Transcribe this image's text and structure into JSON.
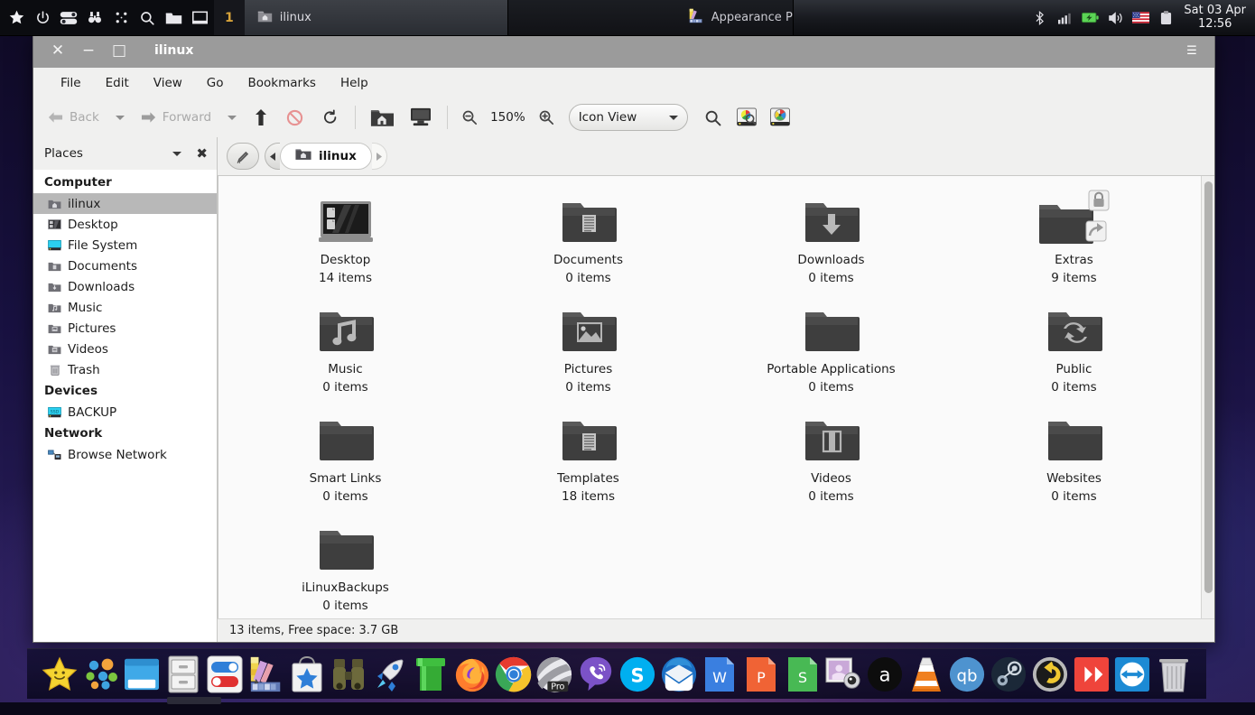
{
  "top_panel": {
    "launcher_icons": [
      "star-icon",
      "power-icon",
      "toggles-icon",
      "binoculars-icon",
      "grid-dots-icon",
      "search-icon",
      "folder-icon",
      "window-icon"
    ],
    "workspace_number": "1",
    "tasks": [
      {
        "label": "ilinux",
        "icon": "home-folder-icon",
        "active": true
      },
      {
        "label": "Appearance Preferences",
        "icon": "appearance-icon",
        "active": false
      }
    ],
    "tray_icons": [
      "bluetooth-icon",
      "signal-icon",
      "battery-icon",
      "volume-icon",
      "us-flag-icon",
      "clipboard-icon"
    ],
    "clock": {
      "date": "Sat 03 Apr",
      "time": "12:56"
    }
  },
  "window": {
    "title": "ilinux",
    "buttons": {
      "close": "✕",
      "minimize": "−",
      "maximize": "□",
      "menu": "☰"
    },
    "menubar": [
      "File",
      "Edit",
      "View",
      "Go",
      "Bookmarks",
      "Help"
    ],
    "toolbar": {
      "back_label": "Back",
      "forward_label": "Forward",
      "up_icon": "up-arrow-icon",
      "stop_icon": "stop-icon",
      "reload_icon": "reload-icon",
      "home_icon": "home-folder-icon",
      "computer_icon": "computer-icon",
      "zoom_out_icon": "zoom-out-icon",
      "zoom_level": "150%",
      "zoom_in_icon": "zoom-in-icon",
      "view_mode": "Icon View",
      "search_icon": "search-icon",
      "disk_usage_icon": "disk-analyzer-icon",
      "disk_info_icon": "disk-info-icon"
    },
    "pathbar": {
      "edit_icon": "pencil-icon",
      "prev_icon": "chevron-left-icon",
      "next_icon": "chevron-right-icon",
      "crumb": {
        "label": "ilinux",
        "icon": "home-folder-icon"
      }
    },
    "sidebar": {
      "header": "Places",
      "header_dropdown_icon": "chevron-down-icon",
      "header_close_icon": "close-icon",
      "groups": [
        {
          "title": "Computer",
          "items": [
            {
              "label": "ilinux",
              "icon": "home-folder-icon",
              "selected": true
            },
            {
              "label": "Desktop",
              "icon": "desktop-icon",
              "selected": false
            },
            {
              "label": "File System",
              "icon": "drive-icon",
              "selected": false
            },
            {
              "label": "Documents",
              "icon": "documents-folder-icon",
              "selected": false
            },
            {
              "label": "Downloads",
              "icon": "downloads-folder-icon",
              "selected": false
            },
            {
              "label": "Music",
              "icon": "music-folder-icon",
              "selected": false
            },
            {
              "label": "Pictures",
              "icon": "pictures-folder-icon",
              "selected": false
            },
            {
              "label": "Videos",
              "icon": "videos-folder-icon",
              "selected": false
            },
            {
              "label": "Trash",
              "icon": "trash-icon",
              "selected": false
            }
          ]
        },
        {
          "title": "Devices",
          "items": [
            {
              "label": "BACKUP",
              "icon": "ssd-drive-icon",
              "selected": false
            }
          ]
        },
        {
          "title": "Network",
          "items": [
            {
              "label": "Browse Network",
              "icon": "network-icon",
              "selected": false
            }
          ]
        }
      ]
    },
    "files": [
      {
        "name": "Desktop",
        "count": "14 items",
        "icon": "desktop-monitor-icon",
        "badge": ""
      },
      {
        "name": "Documents",
        "count": "0 items",
        "icon": "documents-folder-icon",
        "badge": ""
      },
      {
        "name": "Downloads",
        "count": "0 items",
        "icon": "downloads-folder-icon",
        "badge": ""
      },
      {
        "name": "Extras",
        "count": "9 items",
        "icon": "plain-folder-icon",
        "badge": "lock-and-link"
      },
      {
        "name": "Music",
        "count": "0 items",
        "icon": "music-folder-icon",
        "badge": ""
      },
      {
        "name": "Pictures",
        "count": "0 items",
        "icon": "pictures-folder-icon",
        "badge": ""
      },
      {
        "name": "Portable Applications",
        "count": "0 items",
        "icon": "plain-folder-icon",
        "badge": ""
      },
      {
        "name": "Public",
        "count": "0 items",
        "icon": "public-folder-icon",
        "badge": ""
      },
      {
        "name": "Smart Links",
        "count": "0 items",
        "icon": "plain-folder-icon",
        "badge": ""
      },
      {
        "name": "Templates",
        "count": "18 items",
        "icon": "templates-folder-icon",
        "badge": ""
      },
      {
        "name": "Videos",
        "count": "0 items",
        "icon": "videos-folder-icon",
        "badge": ""
      },
      {
        "name": "Websites",
        "count": "0 items",
        "icon": "plain-folder-icon",
        "badge": ""
      },
      {
        "name": "iLinuxBackups",
        "count": "0 items",
        "icon": "plain-folder-icon",
        "badge": ""
      }
    ],
    "statusbar": "13 items, Free space: 3.7 GB"
  },
  "dock": {
    "items": [
      {
        "name": "menu-star",
        "icon": "smiley-star-icon"
      },
      {
        "name": "applications",
        "icon": "colored-dots-icon"
      },
      {
        "name": "window-switcher",
        "icon": "blue-window-icon"
      },
      {
        "name": "file-cabinet",
        "icon": "file-cabinet-icon"
      },
      {
        "name": "settings",
        "icon": "toggles-icon"
      },
      {
        "name": "appearance",
        "icon": "color-palette-icon"
      },
      {
        "name": "software-store",
        "icon": "shopping-bag-star-icon"
      },
      {
        "name": "search-files",
        "icon": "binoculars-icon"
      },
      {
        "name": "launcher",
        "icon": "rocket-icon"
      },
      {
        "name": "terminal",
        "icon": "green-pipe-icon"
      },
      {
        "name": "firefox",
        "icon": "firefox-icon"
      },
      {
        "name": "chrome",
        "icon": "chrome-icon"
      },
      {
        "name": "opera-pro",
        "icon": "pro-browser-icon"
      },
      {
        "name": "viber",
        "icon": "viber-icon"
      },
      {
        "name": "skype",
        "icon": "skype-icon"
      },
      {
        "name": "thunderbird",
        "icon": "thunderbird-icon"
      },
      {
        "name": "writer",
        "icon": "writer-w-icon"
      },
      {
        "name": "impress",
        "icon": "impress-p-icon"
      },
      {
        "name": "calc",
        "icon": "calc-s-icon"
      },
      {
        "name": "screenshot",
        "icon": "screenshot-icon"
      },
      {
        "name": "amazon",
        "icon": "amazon-a-icon"
      },
      {
        "name": "vlc",
        "icon": "vlc-cone-icon"
      },
      {
        "name": "qbittorrent",
        "icon": "qbittorrent-icon"
      },
      {
        "name": "steam",
        "icon": "steam-icon"
      },
      {
        "name": "restore",
        "icon": "undo-arrow-icon"
      },
      {
        "name": "anydesk",
        "icon": "anydesk-icon"
      },
      {
        "name": "teamviewer",
        "icon": "teamviewer-icon"
      },
      {
        "name": "trash",
        "icon": "trash-bin-icon"
      }
    ]
  },
  "colors": {
    "titlebar": "#9b9b9b",
    "selection": "#b8b8b8",
    "panel_dark": "#12141a",
    "accent_orange": "#d7a33a"
  }
}
